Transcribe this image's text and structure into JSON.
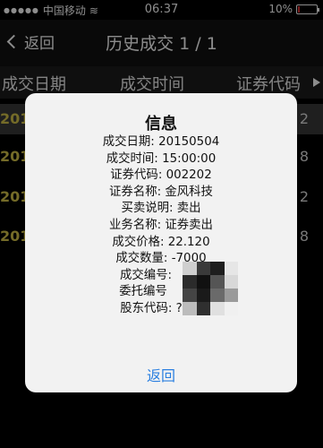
{
  "status_bar": {
    "carrier": "中国移动",
    "time": "06:37",
    "battery": "10%",
    "battery_level": 0.1
  },
  "nav": {
    "back_label": "返回",
    "title": "历史成交 1 / 1"
  },
  "columns": [
    "成交日期",
    "成交时间",
    "证券代码"
  ],
  "rows": [
    {
      "date": "201",
      "code": "2"
    },
    {
      "date": "201",
      "code": "8"
    },
    {
      "date": "201",
      "code": "2"
    },
    {
      "date": "201",
      "code": "8"
    }
  ],
  "dialog": {
    "title": "信息",
    "lines": [
      "成交日期: 20150504",
      "成交时间: 15:00:00",
      "证券代码: 002202",
      "证券名称: 金风科技",
      "买卖说明: 卖出",
      "业务名称: 证券卖出",
      "成交价格: 22.120",
      "成交数量: -7000",
      "成交编号:",
      "委托编号",
      "股东代码: ?"
    ],
    "button_label": "返回"
  },
  "colors": {
    "row_date": "#d3c34a",
    "dialog_bg": "#f2f2f2",
    "dialog_button": "#2a7fe0"
  }
}
